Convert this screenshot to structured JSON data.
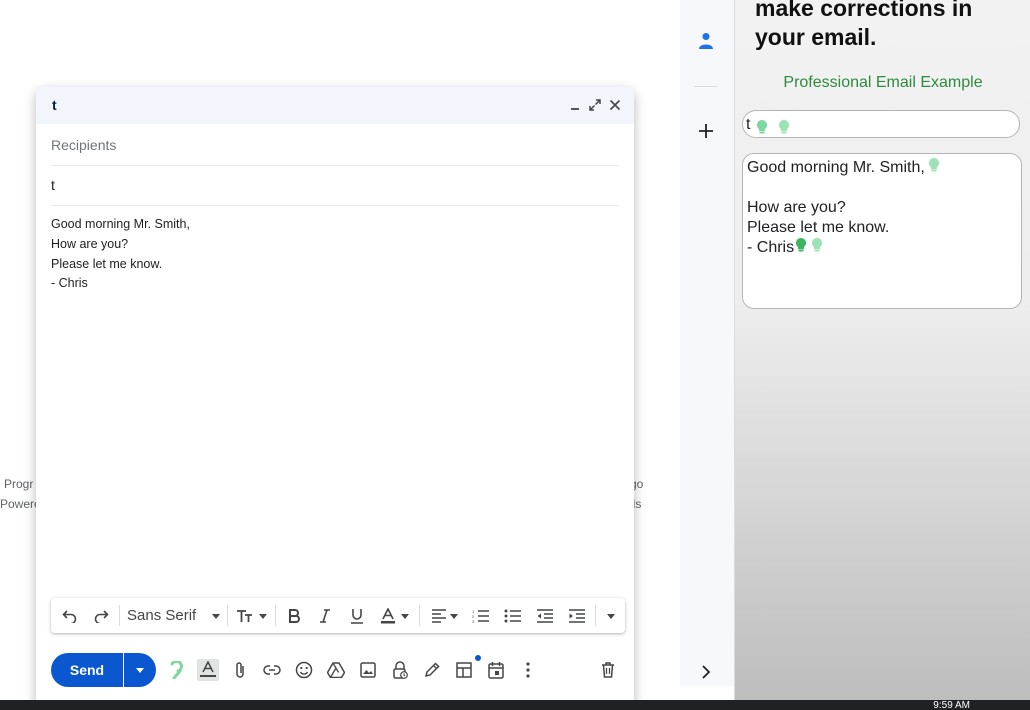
{
  "addon": {
    "heading_line1": "make corrections in",
    "heading_line2": "your email.",
    "subtitle": "Professional Email Example",
    "subject_value": "t",
    "body_lines": [
      "Good morning Mr. Smith,",
      "",
      "How are you?",
      "Please let me know.",
      "- Chris"
    ],
    "accent_color": "#2e8b3c"
  },
  "compose": {
    "title": "t",
    "recipients_placeholder": "Recipients",
    "subject_value": "t",
    "body_lines": [
      "Good morning Mr. Smith,",
      "How are you?",
      "Please let me know.",
      "- Chris"
    ],
    "font_name": "Sans Serif",
    "send_label": "Send"
  },
  "background": {
    "footer_left_line1": "Progr",
    "footer_left_line2": "Powere",
    "footer_right_line1": "go",
    "footer_right_line2": "ils"
  },
  "taskbar": {
    "clock": "9:59 AM"
  },
  "icons": {
    "header": [
      "minimize-icon",
      "expand-icon",
      "close-icon"
    ],
    "formatting": [
      "undo-icon",
      "redo-icon",
      "font-size-icon",
      "bold-icon",
      "italic-icon",
      "underline-icon",
      "text-color-icon",
      "align-icon",
      "numbered-list-icon",
      "bulleted-list-icon",
      "indent-less-icon",
      "indent-more-icon",
      "more-formatting-icon"
    ],
    "bottom": [
      "grammar-icon",
      "formatting-options-icon",
      "attach-icon",
      "link-icon",
      "emoji-icon",
      "drive-icon",
      "photo-icon",
      "confidential-icon",
      "signature-icon",
      "layouts-icon",
      "schedule-icon",
      "more-options-icon",
      "discard-icon"
    ]
  }
}
